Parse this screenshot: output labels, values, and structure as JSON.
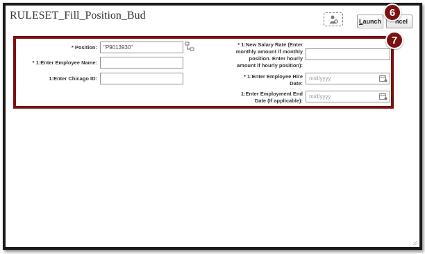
{
  "dialog": {
    "title": "RULESET_Fill_Position_Bud",
    "launch_label_access": "L",
    "launch_label_rest": "aunch",
    "cancel_label": "ncel",
    "callout_launch": "6",
    "callout_form": "7"
  },
  "form": {
    "position": {
      "label": "* Position:",
      "value": "\"P9013930\""
    },
    "employee_name": {
      "label": "* 1:Enter Employee Name:",
      "value": ""
    },
    "chicago_id": {
      "label": "1:Enter Chicago ID:",
      "value": ""
    },
    "salary_rate": {
      "label_line1": "* 1:New Salary Rate (Enter",
      "label_line2": "monthly amount if monthly",
      "label_line3": "position. Enter hourly",
      "label_line4": "amount if hourly position):",
      "value": ""
    },
    "hire_date": {
      "label_line1": "* 1:Enter Employee Hire",
      "label_line2": "Date:",
      "placeholder": "m/d/yyyy"
    },
    "end_date": {
      "label_line1": "1:Enter Employment End",
      "label_line2": "Date (If applicable):",
      "placeholder": "m/d/yyyy"
    }
  },
  "colors": {
    "highlight": "#7b1212",
    "frame": "#1a1a1a"
  },
  "icons": [
    "personalize-icon",
    "lov-hierarchy-icon",
    "calendar-icon",
    "resize-grip-icon"
  ]
}
